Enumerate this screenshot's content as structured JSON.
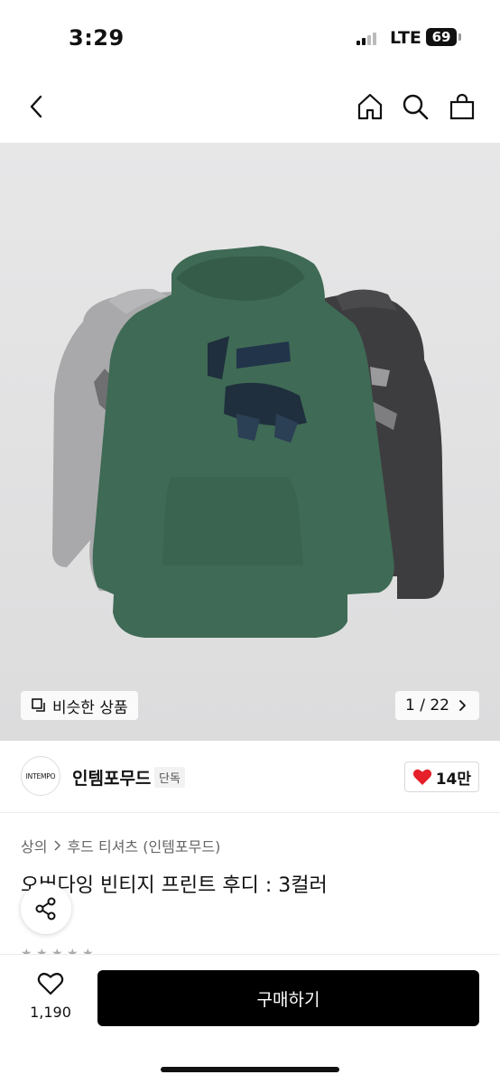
{
  "status_bar": {
    "time": "3:29",
    "network": "LTE",
    "battery": "69"
  },
  "nav": {
    "back_icon": "chevron-left-icon",
    "home_icon": "home-icon",
    "search_icon": "search-icon",
    "cart_icon": "shopping-bag-icon"
  },
  "hero": {
    "similar_label": "비슷한 상품",
    "counter": "1 / 22",
    "colors": [
      "#a9a9ab",
      "#3f6a55",
      "#3d3d3f"
    ]
  },
  "brand": {
    "logo_text": "INTEMPO",
    "name": "인템포무드",
    "tag": "단독",
    "likes": "14만"
  },
  "product": {
    "category": "상의",
    "subcategory": "후드 티셔츠 (인템포무드)",
    "title": "오버다잉 빈티지 프린트 후디 : 3컬러"
  },
  "bottom": {
    "wish_count": "1,190",
    "buy_label": "구매하기"
  }
}
